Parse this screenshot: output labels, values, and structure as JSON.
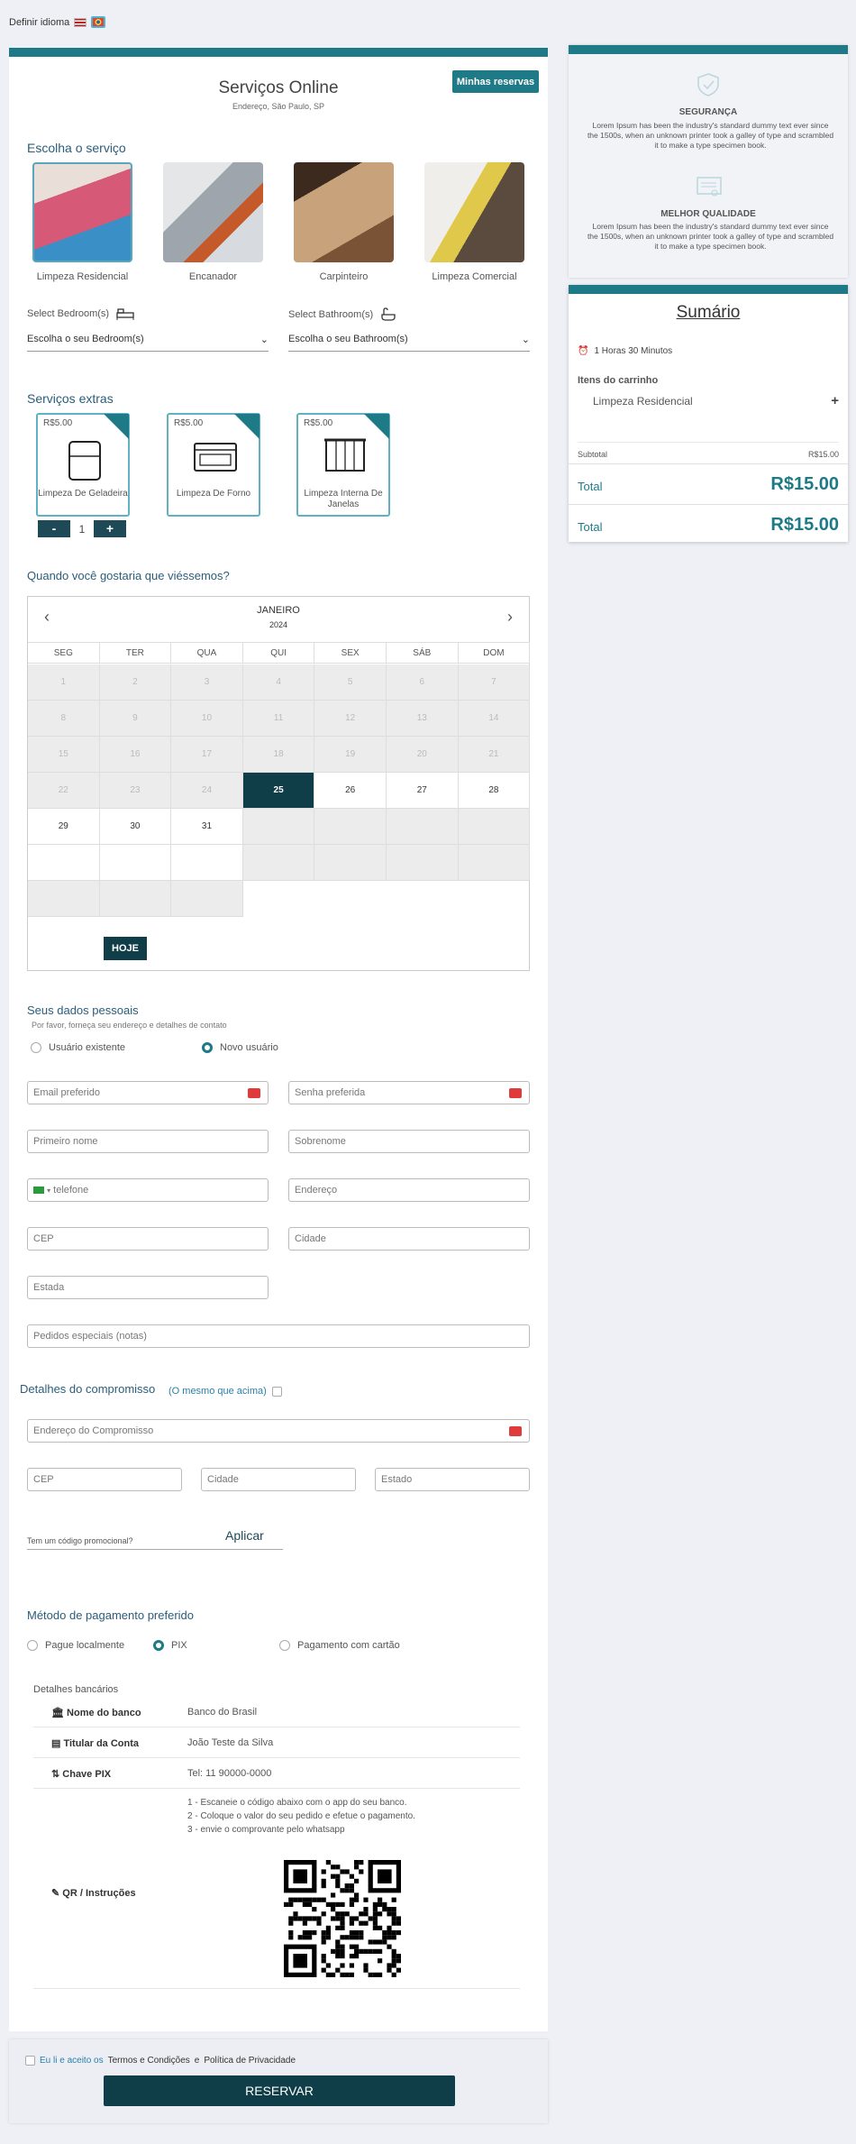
{
  "lang": {
    "label": "Definir idioma"
  },
  "header": {
    "title": "Serviços Online",
    "address": "Endereço, São Paulo, SP",
    "my_bookings": "Minhas reservas"
  },
  "services": {
    "heading": "Escolha o serviço",
    "items": [
      {
        "label": "Limpeza Residencial",
        "selected": true,
        "color": "#c9768a"
      },
      {
        "label": "Encanador",
        "color": "#8a8f96"
      },
      {
        "label": "Carpinteiro",
        "color": "#8a6a52"
      },
      {
        "label": "Limpeza Comercial",
        "color": "#7d7a6a"
      }
    ]
  },
  "bedroom": {
    "label": "Select Bedroom(s)",
    "value": "Escolha o seu Bedroom(s)"
  },
  "bathroom": {
    "label": "Select Bathroom(s)",
    "value": "Escolha o seu Bathroom(s)"
  },
  "extras": {
    "heading": "Serviços extras",
    "items": [
      {
        "price": "R$5.00",
        "label": "Limpeza De Geladeira"
      },
      {
        "price": "R$5.00",
        "label": "Limpeza De Forno"
      },
      {
        "price": "R$5.00",
        "label": "Limpeza Interna De Janelas"
      }
    ],
    "stepper": {
      "minus": "-",
      "value": "1",
      "plus": "+"
    }
  },
  "calendar": {
    "heading": "Quando você gostaria que viéssemos?",
    "month": "JANEIRO",
    "year": "2024",
    "days_of_week": [
      "SEG",
      "TER",
      "QUA",
      "QUI",
      "SEX",
      "SÁB",
      "DOM"
    ],
    "weeks": [
      [
        "1",
        "2",
        "3",
        "4",
        "5",
        "6",
        "7"
      ],
      [
        "8",
        "9",
        "10",
        "11",
        "12",
        "13",
        "14"
      ],
      [
        "15",
        "16",
        "17",
        "18",
        "19",
        "20",
        "21"
      ],
      [
        "22",
        "23",
        "24",
        "25",
        "26",
        "27",
        "28"
      ],
      [
        "29",
        "30",
        "31",
        "",
        "",
        "",
        ""
      ]
    ],
    "today": "25",
    "today_button": "HOJE"
  },
  "personal": {
    "heading": "Seus dados pessoais",
    "subheading": "Por favor, forneça seu endereço e detalhes de contato",
    "existing_user": "Usuário existente",
    "new_user": "Novo usuário",
    "email_placeholder": "Email preferido",
    "password_placeholder": "Senha preferida",
    "first_name_placeholder": "Primeiro nome",
    "last_name_placeholder": "Sobrenome",
    "phone_placeholder": "telefone",
    "address_placeholder": "Endereço",
    "cep_placeholder": "CEP",
    "city_placeholder": "Cidade",
    "state_placeholder": "Estada",
    "notes_placeholder": "Pedidos especiais (notas)"
  },
  "appointment": {
    "heading": "Detalhes do compromisso",
    "same_as_above": "(O mesmo que acima)",
    "address_placeholder": "Endereço do Compromisso",
    "cep_placeholder": "CEP",
    "city_placeholder": "Cidade",
    "state_placeholder": "Estado"
  },
  "promo": {
    "placeholder": "Tem um código promocional?",
    "apply": "Aplicar"
  },
  "payment": {
    "heading": "Método de pagamento preferido",
    "options": [
      "Pague localmente",
      "PIX",
      "Pagamento com cartão"
    ],
    "bank_heading": "Detalhes bancários",
    "rows": [
      {
        "key": "Nome do banco",
        "value": "Banco do Brasil"
      },
      {
        "key": "Titular da Conta",
        "value": "João Teste da Silva"
      },
      {
        "key": "Chave PIX",
        "value": "Tel: 11 90000-0000"
      }
    ],
    "qr_label": "QR / Instruções",
    "instructions": [
      "1 - Escaneie o código abaixo com o app do seu banco.",
      "2 - Coloque o valor do seu pedido e efetue o pagamento.",
      "3 - envie o comprovante pelo whatsapp"
    ]
  },
  "footer": {
    "terms_prefix": "Eu li e aceito os",
    "terms": "Termos e Condições",
    "and": "e",
    "privacy": "Política de Privacidade",
    "reserve": "RESERVAR"
  },
  "sidebar": {
    "security_title": "SEGURANÇA",
    "security_text": "Lorem Ipsum has been the industry's standard dummy text ever since the 1500s, when an unknown printer took a galley of type and scrambled it to make a type specimen book.",
    "quality_title": "MELHOR QUALIDADE",
    "quality_text": "Lorem Ipsum has been the industry's standard dummy text ever since the 1500s, when an unknown printer took a galley of type and scrambled it to make a type specimen book."
  },
  "summary": {
    "title": "Sumário",
    "duration": "1 Horas 30 Minutos",
    "cart_heading": "Itens do carrinho",
    "item": "Limpeza Residencial",
    "subtotal_label": "Subtotal",
    "subtotal_value": "R$15.00",
    "total_label": "Total",
    "total_value": "R$15.00"
  }
}
